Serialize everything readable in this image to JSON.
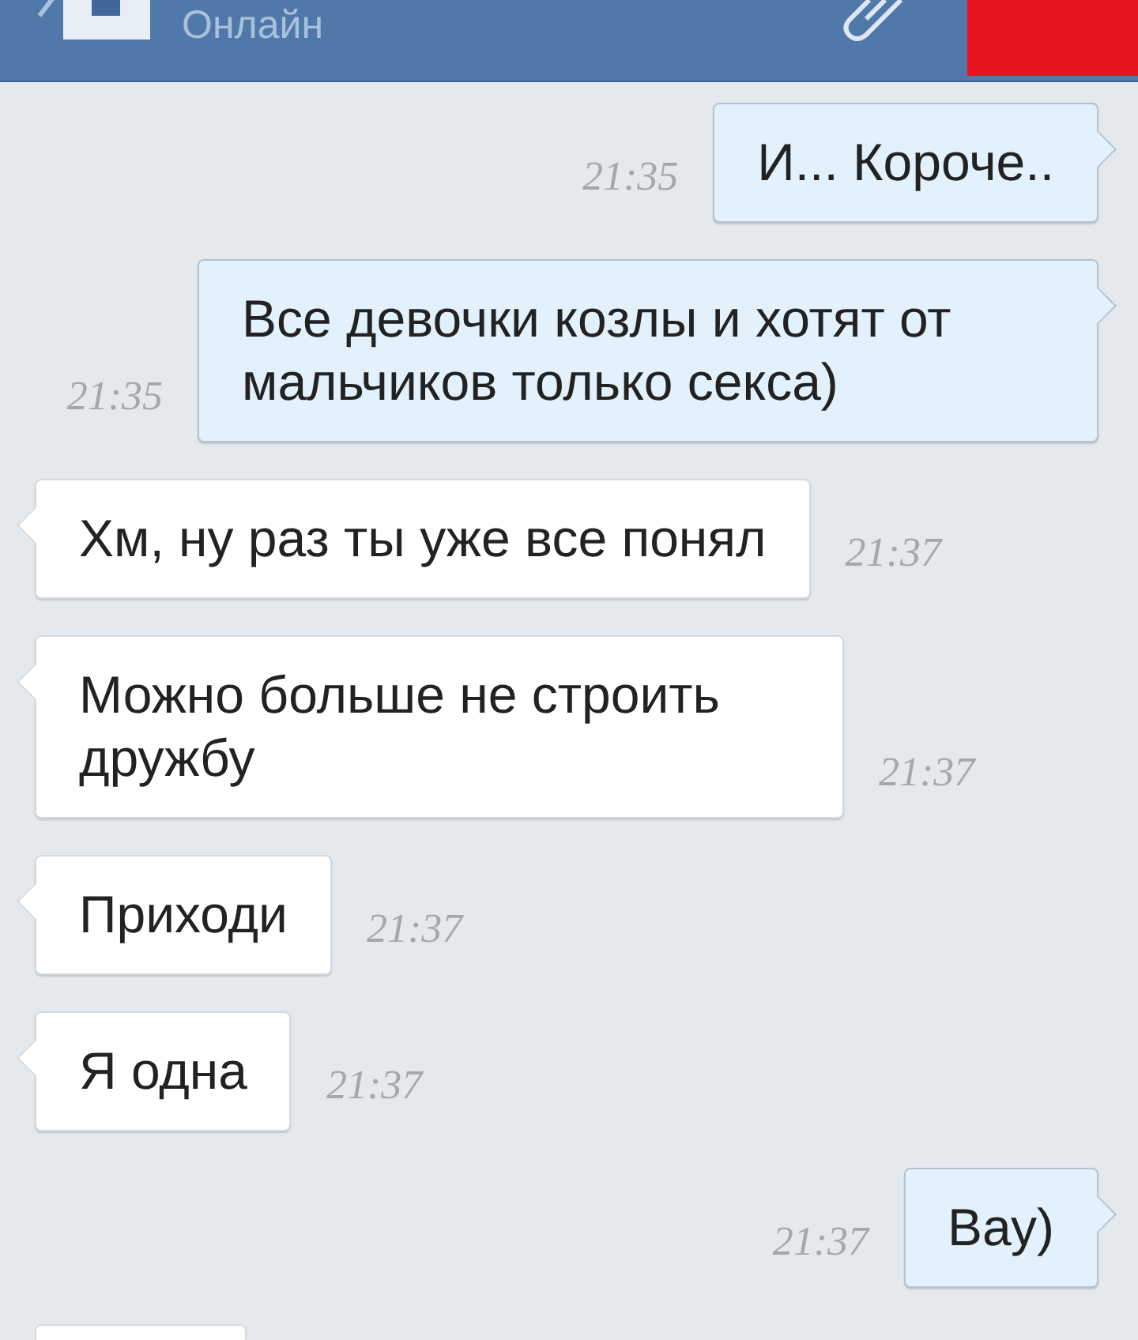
{
  "header": {
    "status": "Онлайн"
  },
  "messages": [
    {
      "kind": "outgoing",
      "text": "И... Короче..",
      "time": "21:35"
    },
    {
      "kind": "outgoing",
      "text": "Все девочки козлы и хотят от мальчиков только секса)",
      "time": "21:35"
    },
    {
      "kind": "incoming",
      "text": "Хм, ну раз ты уже все понял",
      "time": "21:37"
    },
    {
      "kind": "incoming",
      "text": "Можно больше не строить дружбу",
      "time": "21:37"
    },
    {
      "kind": "incoming",
      "text": "Приходи",
      "time": "21:37"
    },
    {
      "kind": "incoming",
      "text": "Я одна",
      "time": "21:37"
    },
    {
      "kind": "outgoing",
      "text": "Вау)",
      "time": "21:37"
    }
  ]
}
